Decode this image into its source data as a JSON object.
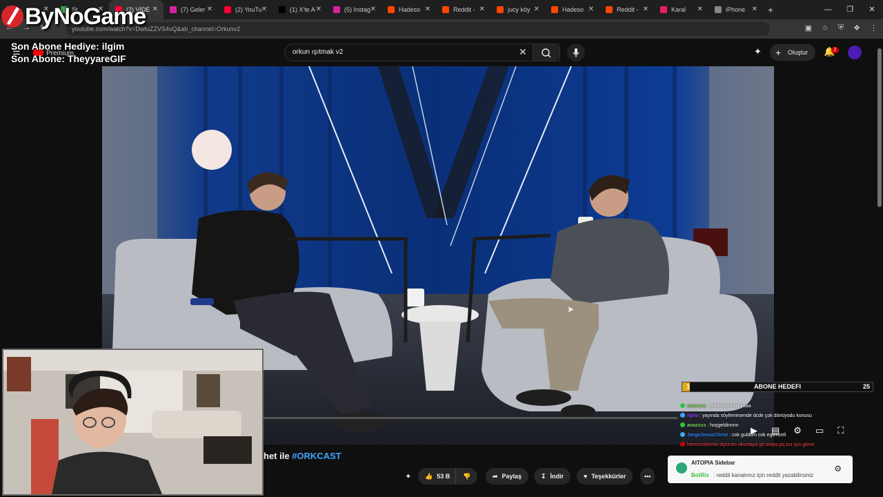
{
  "browser": {
    "tabs": [
      {
        "title": "",
        "fav": "#6a6a6a"
      },
      {
        "title": "St",
        "fav": "#3fa34d"
      },
      {
        "title": "(2) VIDE",
        "fav": "#ff0033",
        "active": true
      },
      {
        "title": "(7) Geler",
        "fav": "#d6249f"
      },
      {
        "title": "(2) YouTu",
        "fav": "#ff0033"
      },
      {
        "title": "(1) X'te A",
        "fav": "#000000"
      },
      {
        "title": "(5) Instag",
        "fav": "#d6249f"
      },
      {
        "title": "Hadeso",
        "fav": "#ff4500"
      },
      {
        "title": "Reddit -",
        "fav": "#ff4500"
      },
      {
        "title": "jucy köy",
        "fav": "#ff4500"
      },
      {
        "title": "Hadeso",
        "fav": "#ff4500"
      },
      {
        "title": "Reddit -",
        "fav": "#ff4500"
      },
      {
        "title": "Karal",
        "fav": "#e91e63"
      },
      {
        "title": "iPhone",
        "fav": "#888888"
      }
    ],
    "url": "youtube.com/watch?v=DwtuZZVS4vQ&ab_channel=Orkunv2"
  },
  "youtube": {
    "premium_label": "Premium",
    "search_value": "orkun ışıtmak v2",
    "create_label": "Oluştur",
    "notif_count": "2",
    "video_title_tail": "het ile ",
    "video_hashtag": "#ORKCAST",
    "like_count": "53 B",
    "share_label": "Paylaş",
    "download_label": "İndir",
    "thanks_label": "Teşekkürler",
    "more_label": "•••"
  },
  "overlay": {
    "logo_text": "ByNoGame",
    "last_gift": "Son Abone Hediye: ilgim",
    "last_sub": "Son Abone: TheyyareGIF",
    "goal_label": "ABONE HEDEFI",
    "goal_current": "1",
    "goal_target": "25",
    "chat": [
      {
        "user": "anazsxs",
        "msg": " : anlamıyoo kiii yaaa",
        "color": "#7ed957",
        "dot": "#35c13f"
      },
      {
        "user": "ilgim",
        "msg": " : yayında söylemesende dcde çok dönüyodu konusu",
        "color": "#9146ff",
        "dot": "#3ea6ff"
      },
      {
        "user": "anazsxs",
        "msg": " : hoşgeldinnnn",
        "color": "#7ed957",
        "dot": "#35c13f"
      },
      {
        "user": "JorgeJesusChrist",
        "msg": " : cok guldum cok eglenceli",
        "color": "#2e86ff",
        "dot": "#3ea6ff"
      },
      {
        "user": "",
        "msg": "hemcinslerime diyorum okumaya git oraya piç kız için gitme",
        "color": "#ff4444",
        "dot": "#cc0000"
      }
    ],
    "sidebar_title": "AITOPIA Sidebar",
    "sidebar_bot": "BotRix",
    "sidebar_msg": ": reddit kanalımız için reddit yazabilirsiniz"
  },
  "colors": {
    "yt_red": "#ff0000",
    "goal_fill": "#e0a81b",
    "hashtag": "#3ea6ff"
  }
}
